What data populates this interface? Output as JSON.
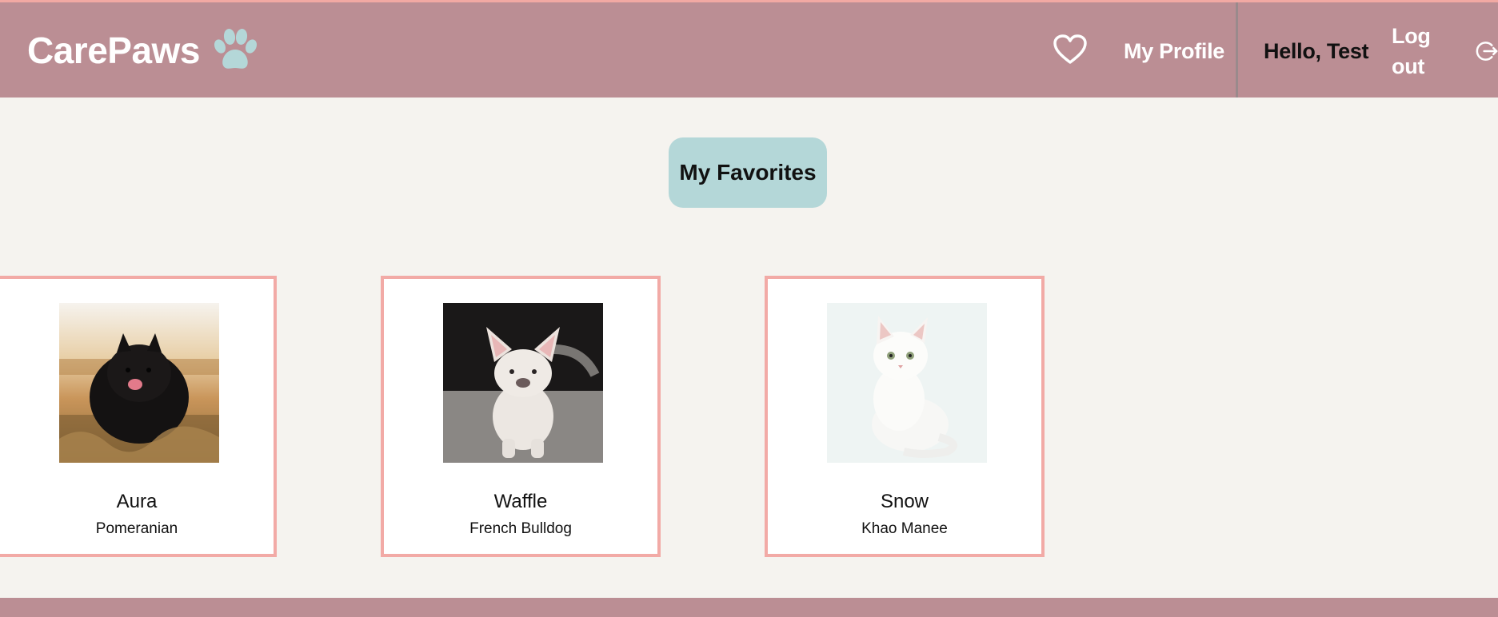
{
  "header": {
    "brand": "CarePaws",
    "brand_icon": "paw-icon",
    "favorites_icon": "heart-outline-icon",
    "profile_link": "My Profile",
    "greeting": "Hello, Test",
    "logout_label": "Log out",
    "logout_icon": "logout-icon"
  },
  "page": {
    "heading": "My Favorites"
  },
  "favorites": [
    {
      "name": "Aura",
      "breed": "Pomeranian",
      "photo": "black-pomeranian-photo"
    },
    {
      "name": "Waffle",
      "breed": "French Bulldog",
      "photo": "white-french-bulldog-photo"
    },
    {
      "name": "Snow",
      "breed": "Khao Manee",
      "photo": "white-cat-photo"
    }
  ],
  "colors": {
    "header_bg": "#bb8e94",
    "page_bg": "#f5f3ef",
    "accent_teal": "#b4d7d8",
    "card_border": "#f2aaa6"
  }
}
